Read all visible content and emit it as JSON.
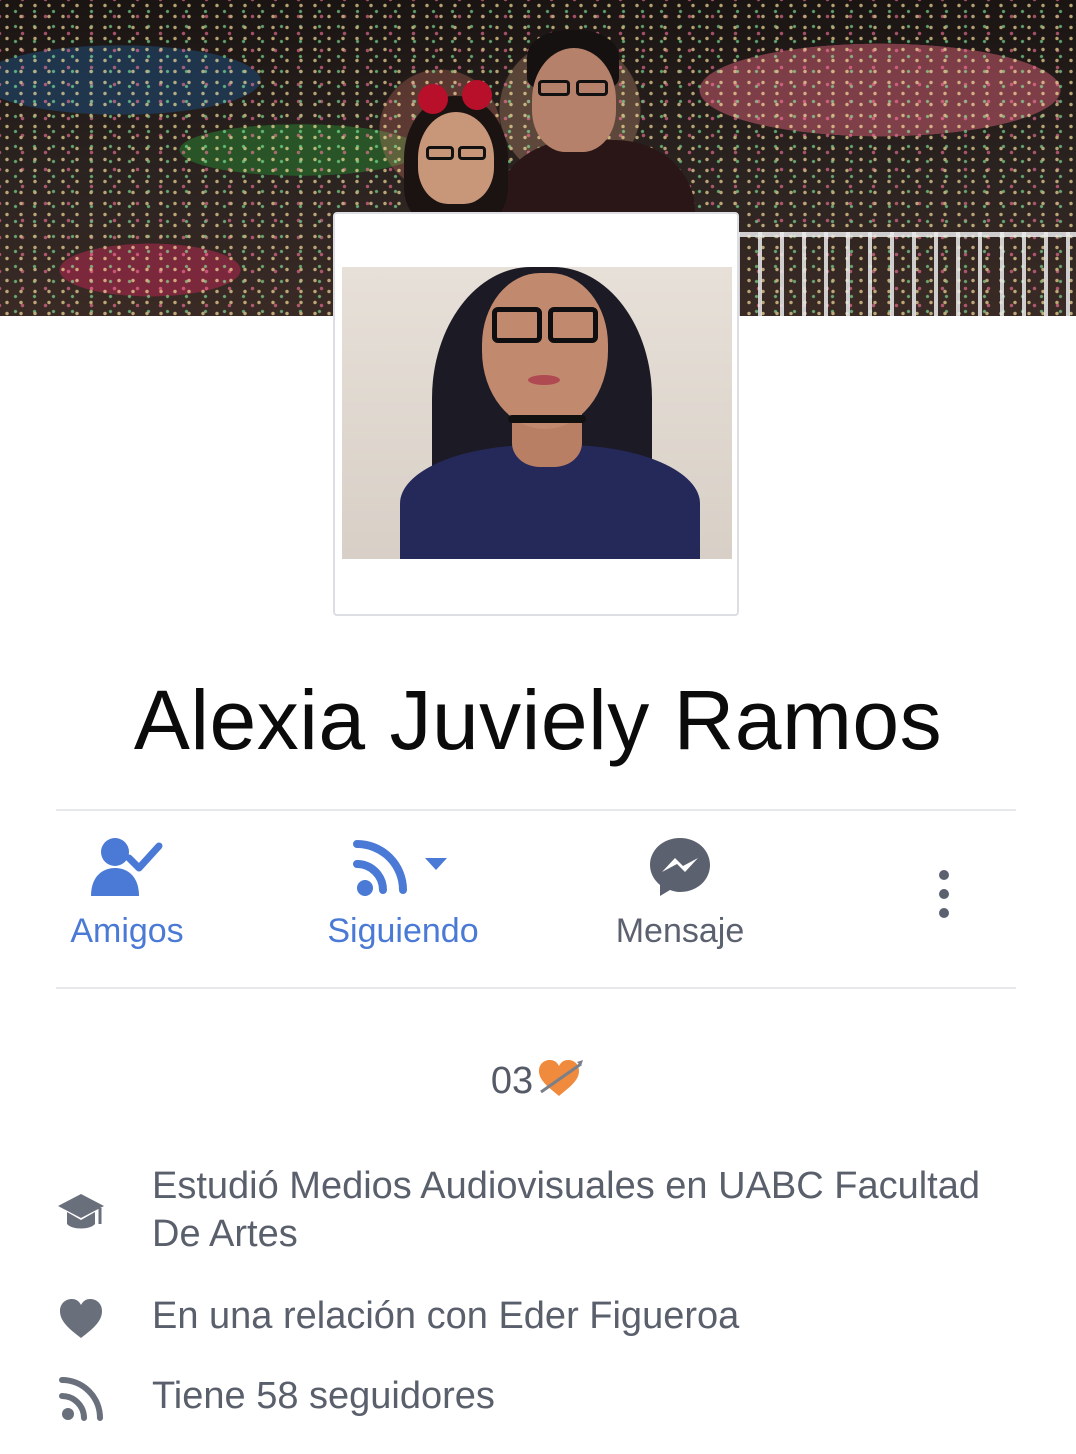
{
  "profile": {
    "name": "Alexia Juviely Ramos",
    "bio_text": "03"
  },
  "actions": [
    {
      "label": "Amigos",
      "icon": "friends-check-icon",
      "color": "#4a79d6"
    },
    {
      "label": "Siguiendo",
      "icon": "rss-follow-icon",
      "color": "#4a79d6"
    },
    {
      "label": "Mensaje",
      "icon": "messenger-icon",
      "color": "#5c6170"
    }
  ],
  "more_icon": "more-vertical-icon",
  "info": {
    "education": {
      "icon": "graduation-cap-icon",
      "text": "Estudió Medios Audiovisuales en UABC Facultad De Artes"
    },
    "relationship": {
      "icon": "heart-icon",
      "text": "En una relación con Eder Figueroa"
    },
    "followers": {
      "icon": "rss-icon",
      "text": "Tiene 58 seguidores"
    }
  },
  "colors": {
    "accent_blue": "#4a79d6",
    "icon_gray": "#5c6170",
    "text_gray": "#5a5f6c"
  }
}
